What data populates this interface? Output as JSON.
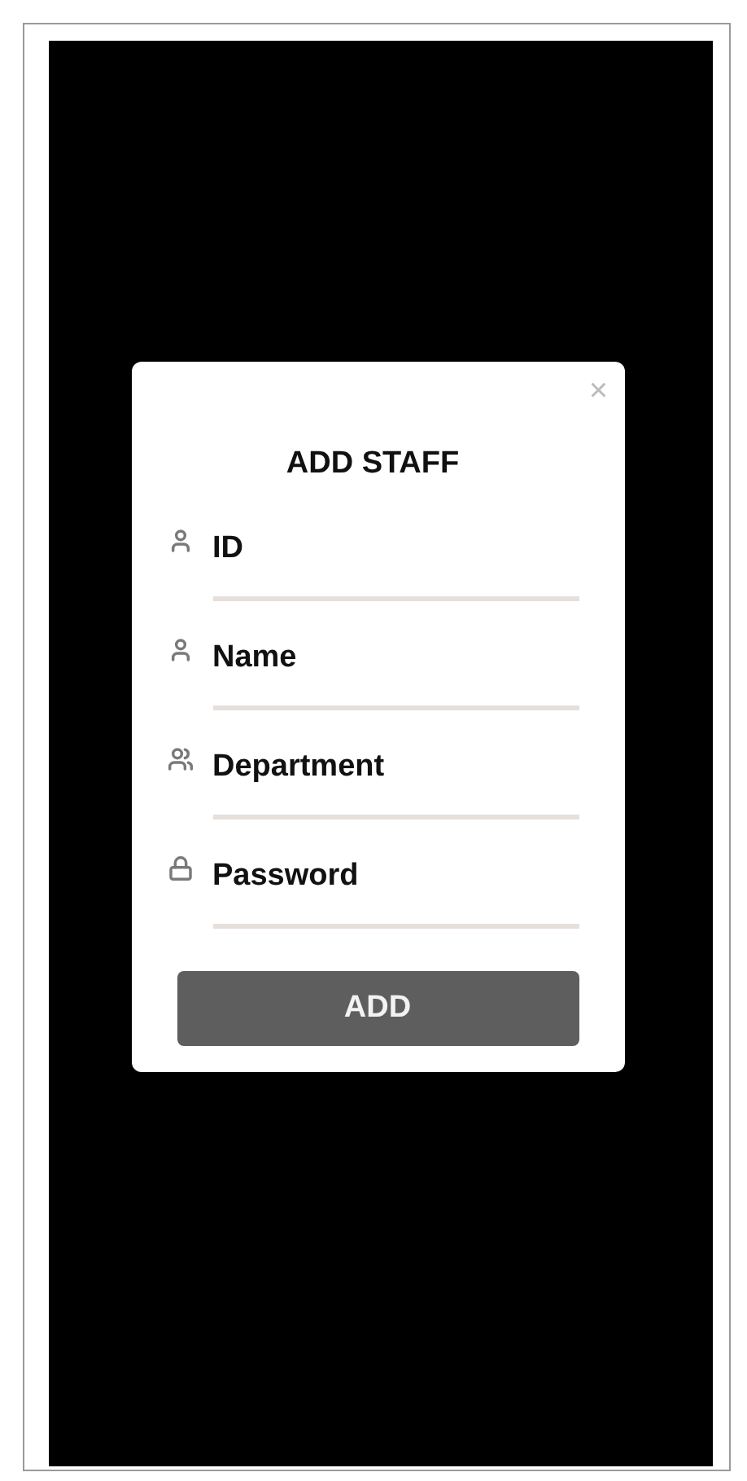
{
  "dialog": {
    "close": "×",
    "title": "ADD STAFF",
    "fields": [
      {
        "placeholder": "ID"
      },
      {
        "placeholder": "Name"
      },
      {
        "placeholder": "Department"
      },
      {
        "placeholder": "Password"
      }
    ],
    "button": "ADD"
  }
}
